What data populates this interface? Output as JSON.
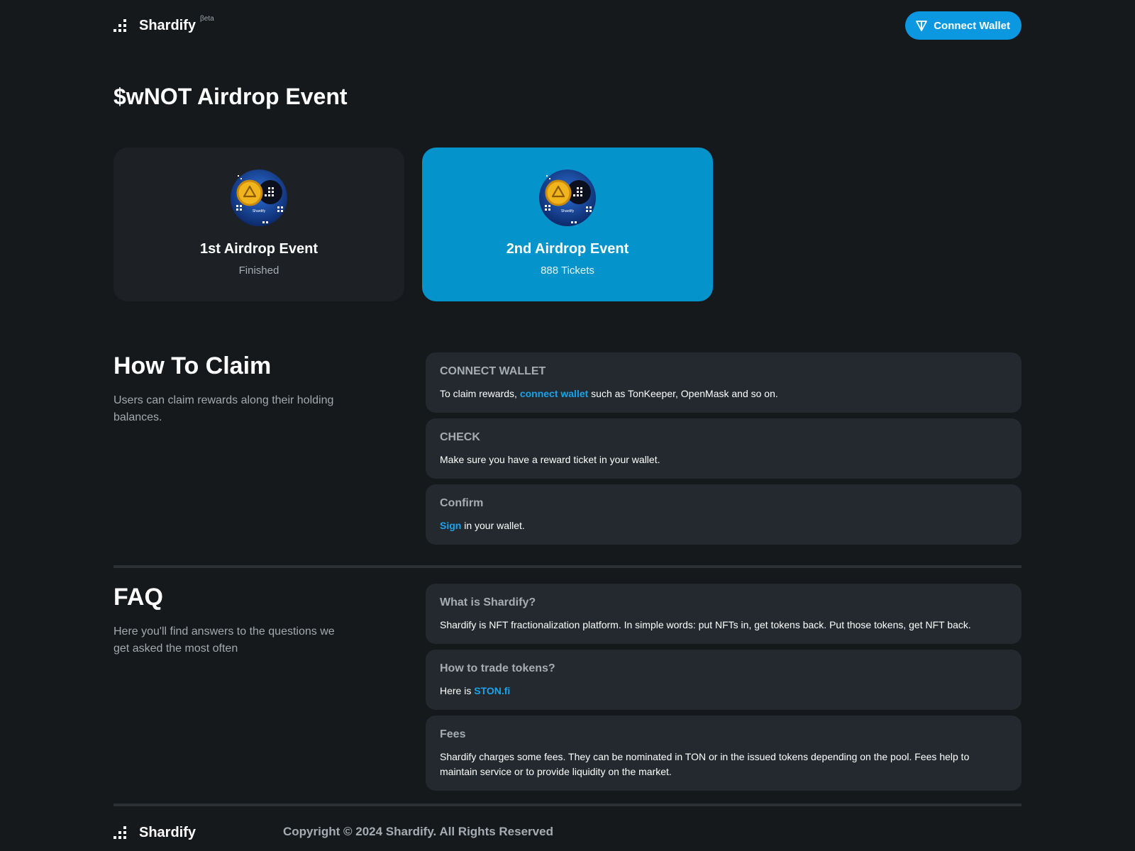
{
  "header": {
    "brand": "Shardify",
    "beta": "βeta",
    "connect_button": "Connect Wallet"
  },
  "page_title": "$wNOT Airdrop Event",
  "events": [
    {
      "title": "1st Airdrop Event",
      "subtitle": "Finished",
      "coin_label": "Shardify"
    },
    {
      "title": "2nd Airdrop Event",
      "subtitle": "888 Tickets",
      "coin_label": "Shardify"
    }
  ],
  "how_to_claim": {
    "title": "How To Claim",
    "description": "Users can claim rewards along their holding balances.",
    "steps": [
      {
        "title": "CONNECT WALLET",
        "prefix": "To claim rewards, ",
        "link": "connect wallet",
        "suffix": " such as TonKeeper, OpenMask and so on."
      },
      {
        "title": "CHECK",
        "text": "Make sure you have a reward ticket in your wallet."
      },
      {
        "title": "Confirm",
        "link": "Sign",
        "suffix": " in your wallet."
      }
    ]
  },
  "faq": {
    "title": "FAQ",
    "description": "Here you'll find answers to the questions we get asked the most often",
    "items": [
      {
        "title": "What is Shardify?",
        "text": "Shardify is NFT fractionalization platform. In simple words: put NFTs in, get tokens back. Put those tokens, get NFT back."
      },
      {
        "title": "How to trade tokens?",
        "prefix": "Here is ",
        "link": "STON.fi"
      },
      {
        "title": "Fees",
        "text": "Shardify charges some fees. They can be nominated in TON or in the issued tokens depending on the pool. Fees help to maintain service or to provide liquidity on the market."
      }
    ]
  },
  "footer": {
    "brand": "Shardify",
    "copyright": "Copyright © 2024 Shardify. All Rights Reserved"
  },
  "colors": {
    "background": "#16191c",
    "card": "#1d2125",
    "active_card": "#0494cb",
    "accent": "#0b98e0",
    "link": "#1aa3ec"
  }
}
